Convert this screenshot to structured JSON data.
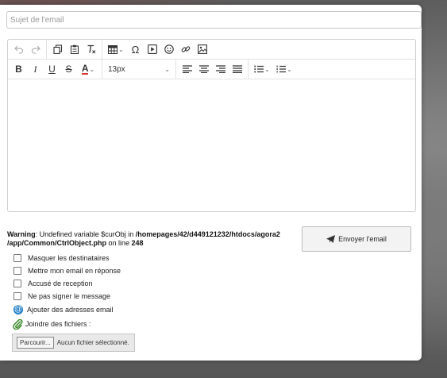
{
  "subject": {
    "placeholder": "Sujet de l'email"
  },
  "toolbar": {
    "row1_icons": [
      "undo-icon",
      "redo-icon",
      "copy-icon",
      "paste-icon",
      "clear-format-icon",
      "table-icon",
      "omega-icon",
      "video-icon",
      "emoji-icon",
      "link-icon",
      "image-icon"
    ],
    "font_size": "13px"
  },
  "warning": {
    "label": "Warning",
    "text": ": Undefined variable $curObj in ",
    "path": "/homepages/42/d449121232/htdocs/agora2 /app/Common/CtrlObject.php",
    "online": " on line ",
    "line": "248"
  },
  "send_button": {
    "label": "Envoyer l'email"
  },
  "options": {
    "hide_recipients": "Masquer les destinataires",
    "reply_to_me": "Mettre mon email en réponse",
    "receipt": "Accusé de reception",
    "no_signature": "Ne pas signer le message",
    "add_emails": "Ajouter des adresses email",
    "attach_files": "Joindre des fichiers :"
  },
  "file_input": {
    "button": "Parcourir...",
    "status": "Aucun fichier sélectionné."
  },
  "colors": {
    "accent": "#1f7ec7",
    "text_color_underline": "#d23b2b"
  }
}
